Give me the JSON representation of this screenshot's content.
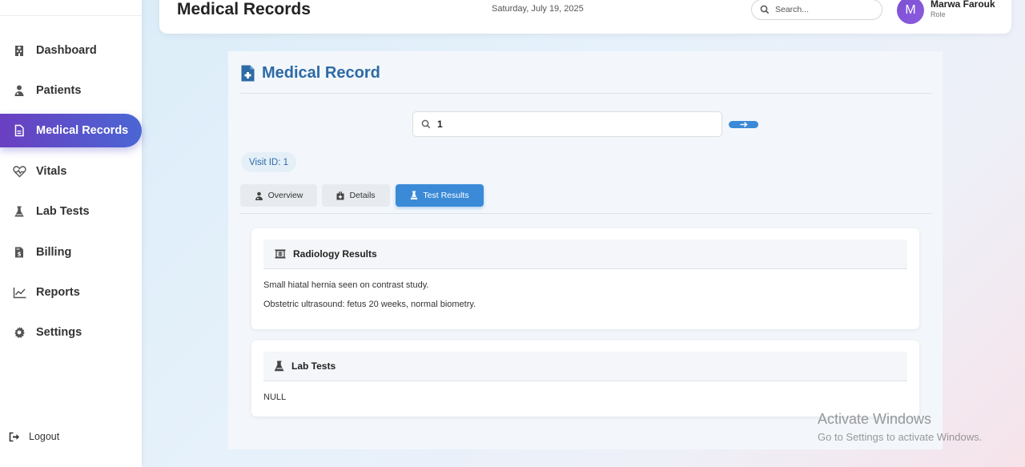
{
  "sidebar": {
    "items": [
      {
        "label": "Dashboard",
        "icon": "hospital-icon"
      },
      {
        "label": "Patients",
        "icon": "patients-icon"
      },
      {
        "label": "Medical Records",
        "icon": "file-medical-icon"
      },
      {
        "label": "Vitals",
        "icon": "heartbeat-icon"
      },
      {
        "label": "Lab Tests",
        "icon": "flask-icon"
      },
      {
        "label": "Billing",
        "icon": "invoice-icon"
      },
      {
        "label": "Reports",
        "icon": "chart-line-icon"
      },
      {
        "label": "Settings",
        "icon": "gear-icon"
      }
    ],
    "active_item": "Medical Records",
    "logout_label": "Logout"
  },
  "header": {
    "title": "Medical Records",
    "date": "Saturday, July 19, 2025",
    "search_placeholder": "Search...",
    "user": {
      "initial": "M",
      "name": "Marwa Farouk",
      "role": "Role"
    }
  },
  "main": {
    "title": "Medical Record",
    "search_value": "1",
    "visit_badge": "Visit ID: 1",
    "tabs": [
      {
        "label": "Overview",
        "icon": "user-doctor-icon"
      },
      {
        "label": "Details",
        "icon": "briefcase-medical-icon"
      },
      {
        "label": "Test Results",
        "icon": "flask-icon"
      }
    ],
    "active_tab": "Test Results",
    "sections": {
      "radiology": {
        "title": "Radiology Results",
        "lines": [
          "Small hiatal hernia seen on contrast study.",
          "Obstetric ultrasound: fetus 20 weeks, normal biometry."
        ]
      },
      "lab_tests": {
        "title": "Lab Tests",
        "value": "NULL"
      }
    }
  },
  "watermark": {
    "line1": "Activate Windows",
    "line2": "Go to Settings to activate Windows."
  },
  "colors": {
    "accent": "#3a8ad8",
    "title_blue": "#2d6aa6",
    "sidebar_active_start": "#6a3fc1",
    "sidebar_active_end": "#4b66d4",
    "avatar": "#7b4fd3"
  }
}
